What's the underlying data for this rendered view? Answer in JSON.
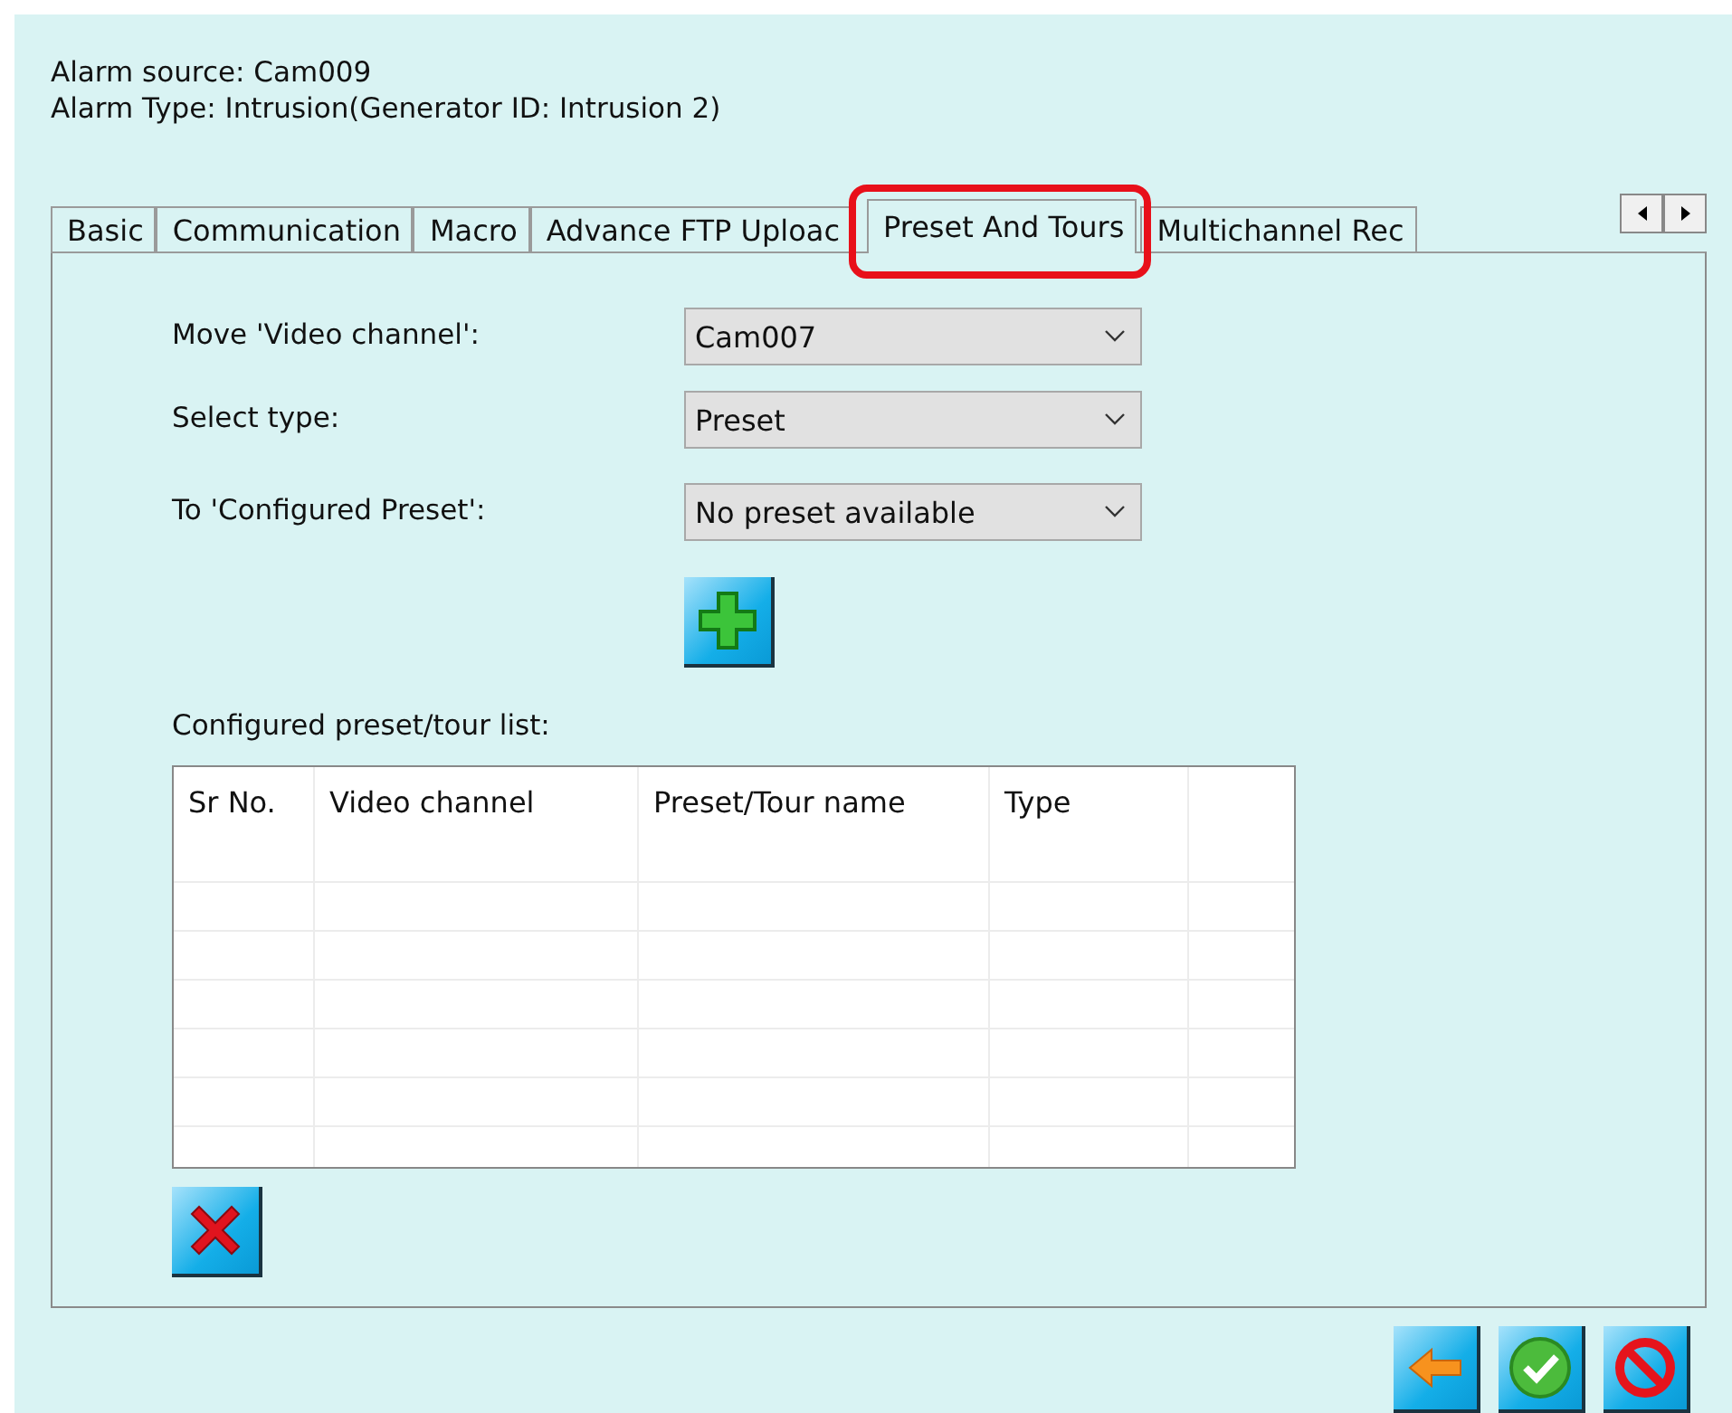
{
  "header": {
    "alarm_source": "Alarm source: Cam009",
    "alarm_type": "Alarm Type: Intrusion(Generator ID: Intrusion 2)"
  },
  "tabs": [
    {
      "label": "Basic",
      "selected": false,
      "highlighted": false
    },
    {
      "label": "Communication",
      "selected": false,
      "highlighted": false
    },
    {
      "label": "Macro",
      "selected": false,
      "highlighted": false
    },
    {
      "label": "Advance FTP Uploac",
      "selected": false,
      "highlighted": false
    },
    {
      "label": "Preset And Tours",
      "selected": true,
      "highlighted": true
    },
    {
      "label": "Multichannel Rec",
      "selected": false,
      "highlighted": false
    }
  ],
  "form": [
    {
      "label": "Move 'Video channel':",
      "value": "Cam007"
    },
    {
      "label": "Select type:",
      "value": "Preset"
    },
    {
      "label": "To 'Configured Preset':",
      "value": "No preset available"
    }
  ],
  "list_label": "Configured preset/tour list:",
  "table": {
    "columns": [
      "Sr No.",
      "Video channel",
      "Preset/Tour name",
      "Type"
    ]
  }
}
